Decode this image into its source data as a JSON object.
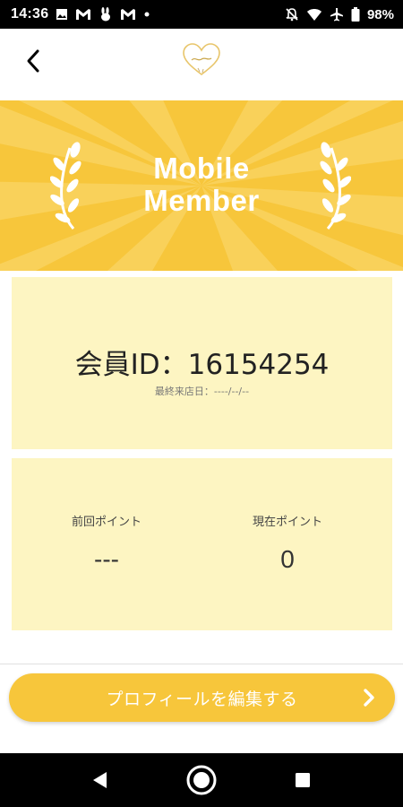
{
  "status_bar": {
    "time": "14:36",
    "battery": "98%",
    "left_icons": [
      "image-icon",
      "gmail-icon",
      "rabbit-icon",
      "gmail-icon",
      "dot-icon"
    ],
    "right_icons": [
      "mute-icon",
      "wifi-icon",
      "airplane-icon",
      "battery-icon"
    ]
  },
  "header": {
    "back_icon": "chevron-left-icon",
    "logo_icon": "heart-logo-icon"
  },
  "banner": {
    "title_line1": "Mobile",
    "title_line2": "Member",
    "color": "#f7c63b"
  },
  "member": {
    "id_text": "会員ID：16154254",
    "last_visit": "最終来店日：----/--/--"
  },
  "points": {
    "previous_label": "前回ポイント",
    "previous_value": "---",
    "current_label": "現在ポイント",
    "current_value": "0"
  },
  "actions": {
    "edit_profile_label": "プロフィールを編集する"
  },
  "nav": {
    "icons": [
      "back-triangle-icon",
      "home-circle-icon",
      "recents-square-icon"
    ]
  },
  "colors": {
    "accent": "#f7c63b",
    "card_bg": "#fdf5c2"
  }
}
